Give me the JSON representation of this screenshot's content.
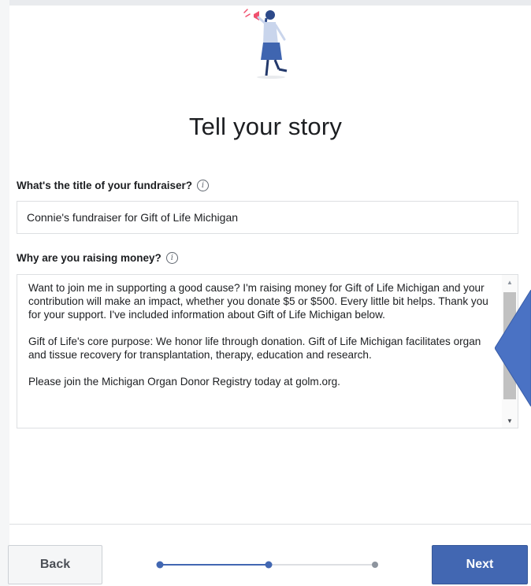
{
  "header": {
    "title": "Tell your story",
    "illustration": "person-with-megaphone-illustration"
  },
  "fundraiser_title": {
    "label": "What's the title of your fundraiser?",
    "value": "Connie's fundraiser for Gift of Life Michigan",
    "info_icon": "info-icon"
  },
  "story": {
    "label": "Why are you raising money?",
    "info_icon": "info-icon",
    "paragraphs": [
      "Want to join me in supporting a good cause? I'm raising money for Gift of Life Michigan and your contribution will make an impact, whether you donate $5 or $500. Every little bit helps. Thank you for your support. I've included information about Gift of Life Michigan below.",
      "Gift of Life's core purpose: We honor life through donation. Gift of Life Michigan facilitates organ and tissue recovery for transplantation, therapy, education and research.",
      "Please join the Michigan Organ Donor Registry today at golm.org."
    ]
  },
  "footer": {
    "back_label": "Back",
    "next_label": "Next",
    "progress": {
      "total_steps": 3,
      "current_step": 2
    }
  },
  "colors": {
    "primary": "#4267b2",
    "callout_arrow": "#4a72c4",
    "border": "#dddfe2"
  }
}
